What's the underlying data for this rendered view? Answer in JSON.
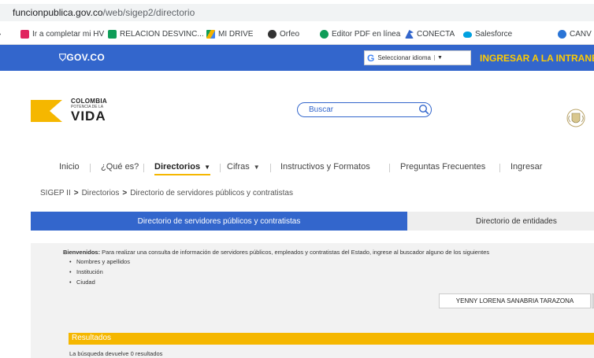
{
  "browser": {
    "url_domain": "funcionpublica.gov.co",
    "url_path": "/web/sigep2/directorio"
  },
  "bookmarks": [
    {
      "label": "Ir a completar mi HV",
      "icon": "mhv-icon",
      "color": "#e0245e"
    },
    {
      "label": "RELACION DESVINC...",
      "icon": "sheets-plus-icon",
      "color": "#0f9d58"
    },
    {
      "label": "MI DRIVE",
      "icon": "drive-icon",
      "color": "#f4b400"
    },
    {
      "label": "Orfeo",
      "icon": "orfeo-icon",
      "color": "#333333"
    },
    {
      "label": "Editor PDF en línea",
      "icon": "sejda-icon",
      "color": "#0f9d58"
    },
    {
      "label": "CONECTA",
      "icon": "conecta-icon",
      "color": "#3366cc"
    },
    {
      "label": "Salesforce",
      "icon": "salesforce-cloud-icon",
      "color": "#00a1e0"
    },
    {
      "label": "CANV",
      "icon": "canva-icon",
      "color": "#2a74d6"
    }
  ],
  "govbar": {
    "logo": "GOV.CO",
    "language_label": "Seleccionar idioma",
    "intranet_link": "INGRESAR A LA INTRANET"
  },
  "header": {
    "logo_line1": "COLOMBIA",
    "logo_line2": "POTENCIA DE LA",
    "logo_line3": "VIDA",
    "search_placeholder": "Buscar"
  },
  "nav": {
    "items": [
      {
        "label": "Inicio"
      },
      {
        "label": "¿Qué es?"
      },
      {
        "label": "Directorios"
      },
      {
        "label": "Cifras"
      },
      {
        "label": "Instructivos y Formatos"
      },
      {
        "label": "Preguntas Frecuentes"
      },
      {
        "label": "Ingresar"
      }
    ]
  },
  "breadcrumb": {
    "items": [
      "SIGEP II",
      "Directorios",
      "Directorio de servidores públicos y contratistas"
    ]
  },
  "tabs": {
    "active": "Directorio de servidores públicos y contratistas",
    "inactive": "Directorio de entidades"
  },
  "content": {
    "welcome_bold": "Bienvenidos:",
    "welcome_text": " Para realizar una consulta de información de servidores públicos, empleados y contratistas del Estado, ingrese al buscador alguno de los siguientes",
    "criteria": [
      "Nombres y apellidos",
      "Institución",
      "Ciudad"
    ],
    "query_value": "YENNY LORENA SANABRIA TARAZONA",
    "results_title": "Resultados",
    "results_text": "La búsqueda devuelve 0 resultados"
  },
  "colors": {
    "gov_blue": "#3366cc",
    "accent_yellow": "#f5b700",
    "intranet_yellow": "#ffcc00"
  }
}
